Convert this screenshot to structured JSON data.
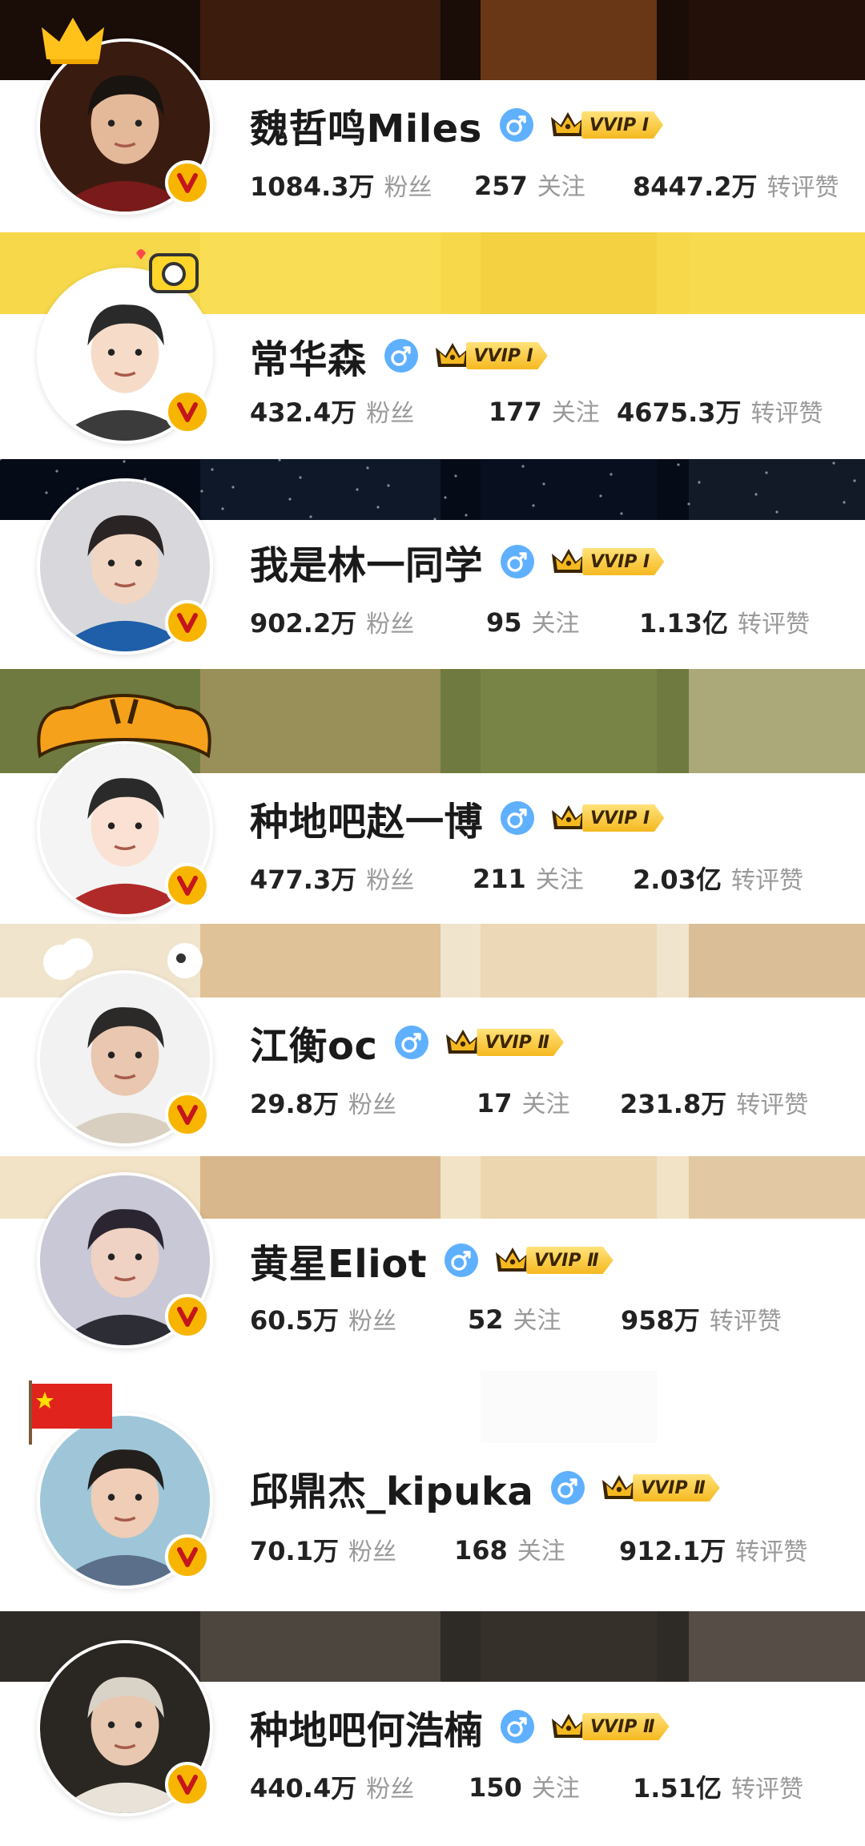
{
  "colors": {
    "verified_badge": "#f7b500",
    "gender_male": "#5fb0ff",
    "vvip_gold": "#f5b920"
  },
  "icons": {
    "gender": "male-symbol-icon",
    "verified": "v-badge-icon",
    "vvip": "crown-icon"
  },
  "profiles": [
    {
      "name": "魏哲鸣Miles",
      "vip": "VVIP Ⅰ",
      "fans_count": "1084.3万",
      "fans_label": "粉丝",
      "following_count": "257",
      "following_label": "关注",
      "likes_count": "8447.2万",
      "likes_label": "转评赞"
    },
    {
      "name": "常华森",
      "vip": "VVIP Ⅰ",
      "fans_count": "432.4万",
      "fans_label": "粉丝",
      "following_count": "177",
      "following_label": "关注",
      "likes_count": "4675.3万",
      "likes_label": "转评赞"
    },
    {
      "name": "我是林一同学",
      "vip": "VVIP Ⅰ",
      "fans_count": "902.2万",
      "fans_label": "粉丝",
      "following_count": "95",
      "following_label": "关注",
      "likes_count": "1.13亿",
      "likes_label": "转评赞"
    },
    {
      "name": "种地吧赵一博",
      "vip": "VVIP Ⅰ",
      "fans_count": "477.3万",
      "fans_label": "粉丝",
      "following_count": "211",
      "following_label": "关注",
      "likes_count": "2.03亿",
      "likes_label": "转评赞"
    },
    {
      "name": "江衡oc",
      "vip": "VVIP Ⅱ",
      "fans_count": "29.8万",
      "fans_label": "粉丝",
      "following_count": "17",
      "following_label": "关注",
      "likes_count": "231.8万",
      "likes_label": "转评赞"
    },
    {
      "name": "黄星Eliot",
      "vip": "VVIP Ⅱ",
      "fans_count": "60.5万",
      "fans_label": "粉丝",
      "following_count": "52",
      "following_label": "关注",
      "likes_count": "958万",
      "likes_label": "转评赞"
    },
    {
      "name": "邱鼎杰_kipuka",
      "vip": "VVIP Ⅱ",
      "fans_count": "70.1万",
      "fans_label": "粉丝",
      "following_count": "168",
      "following_label": "关注",
      "likes_count": "912.1万",
      "likes_label": "转评赞"
    },
    {
      "name": "种地吧何浩楠",
      "vip": "VVIP Ⅱ",
      "fans_count": "440.4万",
      "fans_label": "粉丝",
      "following_count": "150",
      "following_label": "关注",
      "likes_count": "1.51亿",
      "likes_label": "转评赞"
    }
  ]
}
